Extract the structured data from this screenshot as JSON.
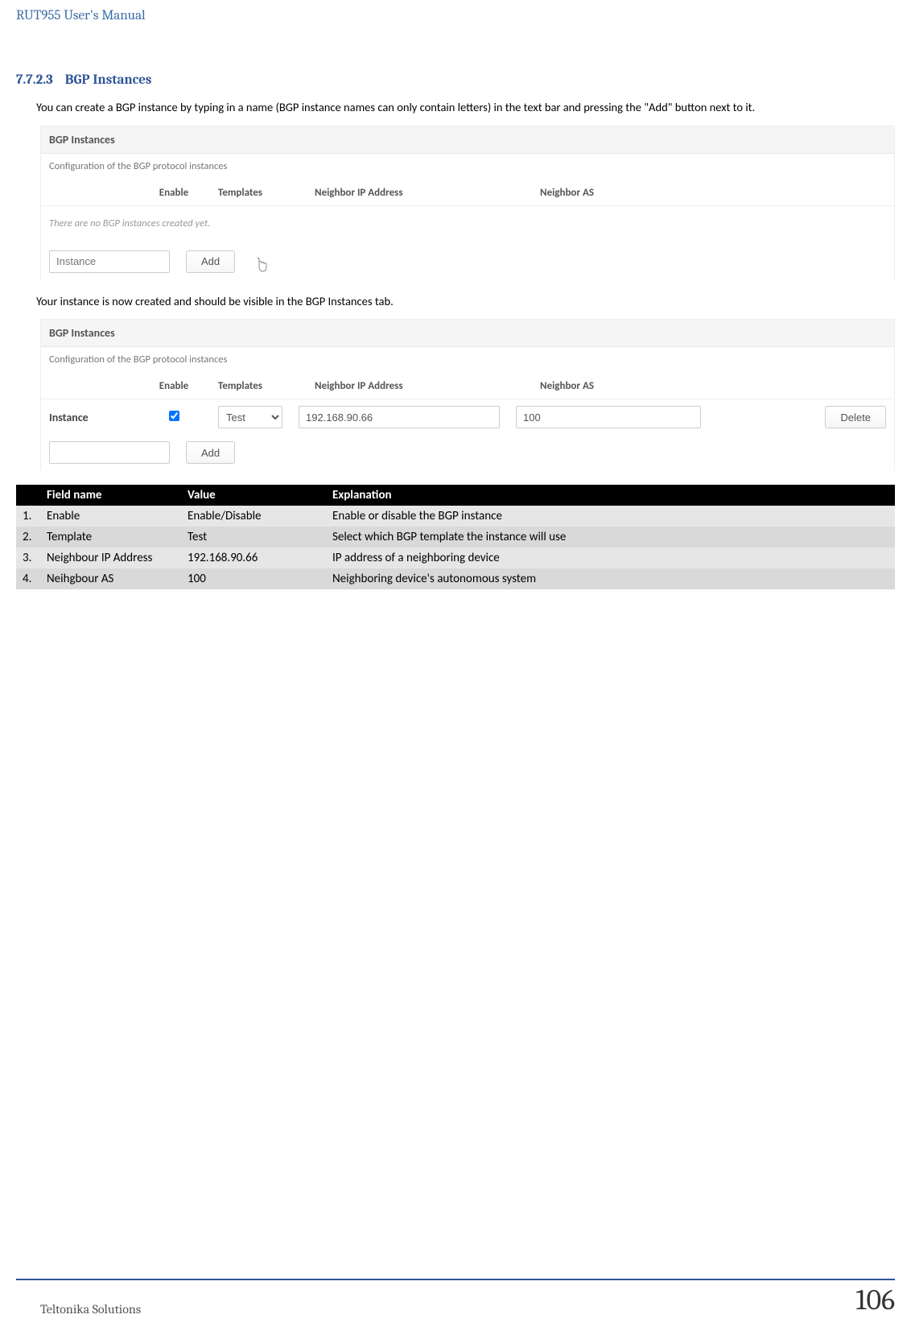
{
  "doc_title": "RUT955 User's Manual",
  "section": {
    "number": "7.7.2.3",
    "title": "BGP Instances"
  },
  "intro_1": "You can create a BGP instance by typing in a name (BGP instance names can only contain letters) in the text bar and pressing the \"Add\" button next to it.",
  "intro_2": "Your instance is now created and should be visible in the BGP Instances tab.",
  "ui": {
    "panel_title": "BGP Instances",
    "panel_subtitle": "Configuration of the BGP protocol instances",
    "cols": {
      "enable": "Enable",
      "templates": "Templates",
      "ip": "Neighbor IP Address",
      "as": "Neighbor AS"
    },
    "empty_msg": "There are no BGP instances created yet.",
    "instance_placeholder": "Instance",
    "add_label": "Add",
    "row": {
      "name": "Instance",
      "template": "Test",
      "ip": "192.168.90.66",
      "as": "100",
      "delete": "Delete"
    }
  },
  "table": {
    "h_field": "Field name",
    "h_value": "Value",
    "h_expl": "Explanation",
    "rows": [
      {
        "n": "1.",
        "field": "Enable",
        "value": "Enable/Disable",
        "expl": "Enable or disable the BGP instance"
      },
      {
        "n": "2.",
        "field": "Template",
        "value": "Test",
        "expl": "Select which BGP template the instance will use"
      },
      {
        "n": "3.",
        "field": "Neighbour IP Address",
        "value": "192.168.90.66",
        "expl": "IP address of a neighboring device"
      },
      {
        "n": "4.",
        "field": "Neihgbour AS",
        "value": "100",
        "expl": "Neighboring device's autonomous system"
      }
    ]
  },
  "footer_left": "Teltonika Solutions",
  "footer_page": "106"
}
